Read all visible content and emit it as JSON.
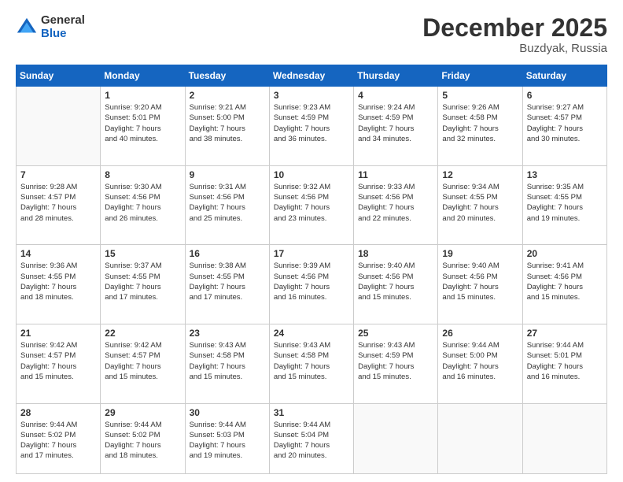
{
  "header": {
    "logo": {
      "general": "General",
      "blue": "Blue"
    },
    "title": "December 2025",
    "location": "Buzdyak, Russia"
  },
  "weekdays": [
    "Sunday",
    "Monday",
    "Tuesday",
    "Wednesday",
    "Thursday",
    "Friday",
    "Saturday"
  ],
  "weeks": [
    [
      {
        "day": "",
        "info": ""
      },
      {
        "day": "1",
        "info": "Sunrise: 9:20 AM\nSunset: 5:01 PM\nDaylight: 7 hours\nand 40 minutes."
      },
      {
        "day": "2",
        "info": "Sunrise: 9:21 AM\nSunset: 5:00 PM\nDaylight: 7 hours\nand 38 minutes."
      },
      {
        "day": "3",
        "info": "Sunrise: 9:23 AM\nSunset: 4:59 PM\nDaylight: 7 hours\nand 36 minutes."
      },
      {
        "day": "4",
        "info": "Sunrise: 9:24 AM\nSunset: 4:59 PM\nDaylight: 7 hours\nand 34 minutes."
      },
      {
        "day": "5",
        "info": "Sunrise: 9:26 AM\nSunset: 4:58 PM\nDaylight: 7 hours\nand 32 minutes."
      },
      {
        "day": "6",
        "info": "Sunrise: 9:27 AM\nSunset: 4:57 PM\nDaylight: 7 hours\nand 30 minutes."
      }
    ],
    [
      {
        "day": "7",
        "info": "Sunrise: 9:28 AM\nSunset: 4:57 PM\nDaylight: 7 hours\nand 28 minutes."
      },
      {
        "day": "8",
        "info": "Sunrise: 9:30 AM\nSunset: 4:56 PM\nDaylight: 7 hours\nand 26 minutes."
      },
      {
        "day": "9",
        "info": "Sunrise: 9:31 AM\nSunset: 4:56 PM\nDaylight: 7 hours\nand 25 minutes."
      },
      {
        "day": "10",
        "info": "Sunrise: 9:32 AM\nSunset: 4:56 PM\nDaylight: 7 hours\nand 23 minutes."
      },
      {
        "day": "11",
        "info": "Sunrise: 9:33 AM\nSunset: 4:56 PM\nDaylight: 7 hours\nand 22 minutes."
      },
      {
        "day": "12",
        "info": "Sunrise: 9:34 AM\nSunset: 4:55 PM\nDaylight: 7 hours\nand 20 minutes."
      },
      {
        "day": "13",
        "info": "Sunrise: 9:35 AM\nSunset: 4:55 PM\nDaylight: 7 hours\nand 19 minutes."
      }
    ],
    [
      {
        "day": "14",
        "info": "Sunrise: 9:36 AM\nSunset: 4:55 PM\nDaylight: 7 hours\nand 18 minutes."
      },
      {
        "day": "15",
        "info": "Sunrise: 9:37 AM\nSunset: 4:55 PM\nDaylight: 7 hours\nand 17 minutes."
      },
      {
        "day": "16",
        "info": "Sunrise: 9:38 AM\nSunset: 4:55 PM\nDaylight: 7 hours\nand 17 minutes."
      },
      {
        "day": "17",
        "info": "Sunrise: 9:39 AM\nSunset: 4:56 PM\nDaylight: 7 hours\nand 16 minutes."
      },
      {
        "day": "18",
        "info": "Sunrise: 9:40 AM\nSunset: 4:56 PM\nDaylight: 7 hours\nand 15 minutes."
      },
      {
        "day": "19",
        "info": "Sunrise: 9:40 AM\nSunset: 4:56 PM\nDaylight: 7 hours\nand 15 minutes."
      },
      {
        "day": "20",
        "info": "Sunrise: 9:41 AM\nSunset: 4:56 PM\nDaylight: 7 hours\nand 15 minutes."
      }
    ],
    [
      {
        "day": "21",
        "info": "Sunrise: 9:42 AM\nSunset: 4:57 PM\nDaylight: 7 hours\nand 15 minutes."
      },
      {
        "day": "22",
        "info": "Sunrise: 9:42 AM\nSunset: 4:57 PM\nDaylight: 7 hours\nand 15 minutes."
      },
      {
        "day": "23",
        "info": "Sunrise: 9:43 AM\nSunset: 4:58 PM\nDaylight: 7 hours\nand 15 minutes."
      },
      {
        "day": "24",
        "info": "Sunrise: 9:43 AM\nSunset: 4:58 PM\nDaylight: 7 hours\nand 15 minutes."
      },
      {
        "day": "25",
        "info": "Sunrise: 9:43 AM\nSunset: 4:59 PM\nDaylight: 7 hours\nand 15 minutes."
      },
      {
        "day": "26",
        "info": "Sunrise: 9:44 AM\nSunset: 5:00 PM\nDaylight: 7 hours\nand 16 minutes."
      },
      {
        "day": "27",
        "info": "Sunrise: 9:44 AM\nSunset: 5:01 PM\nDaylight: 7 hours\nand 16 minutes."
      }
    ],
    [
      {
        "day": "28",
        "info": "Sunrise: 9:44 AM\nSunset: 5:02 PM\nDaylight: 7 hours\nand 17 minutes."
      },
      {
        "day": "29",
        "info": "Sunrise: 9:44 AM\nSunset: 5:02 PM\nDaylight: 7 hours\nand 18 minutes."
      },
      {
        "day": "30",
        "info": "Sunrise: 9:44 AM\nSunset: 5:03 PM\nDaylight: 7 hours\nand 19 minutes."
      },
      {
        "day": "31",
        "info": "Sunrise: 9:44 AM\nSunset: 5:04 PM\nDaylight: 7 hours\nand 20 minutes."
      },
      {
        "day": "",
        "info": ""
      },
      {
        "day": "",
        "info": ""
      },
      {
        "day": "",
        "info": ""
      }
    ]
  ]
}
